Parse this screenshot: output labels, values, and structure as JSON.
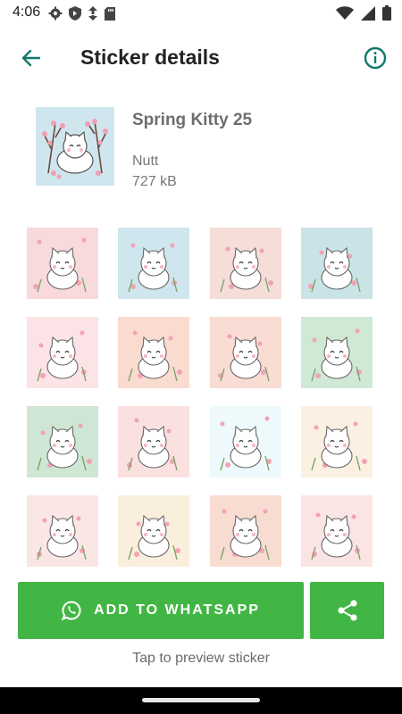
{
  "status_bar": {
    "time": "4:06",
    "left_icons": [
      "gear-icon",
      "shield-icon",
      "data-saver-icon",
      "sd-card-icon"
    ],
    "right_icons": [
      "wifi-icon",
      "signal-icon",
      "battery-icon"
    ]
  },
  "app_bar": {
    "title": "Sticker details",
    "back_icon": "arrow-left-icon",
    "info_icon": "info-icon",
    "accent": "#0f7a6b"
  },
  "pack": {
    "name": "Spring Kitty 25",
    "author": "Nutt",
    "size": "727 kB"
  },
  "stickers": [
    {
      "bg": "#f8d9dc",
      "motif": "winking-kitty"
    },
    {
      "bg": "#cfe6ee",
      "motif": "kitty-cherry-branches"
    },
    {
      "bg": "#f6ddd8",
      "motif": "sleeping-kitty-flowers"
    },
    {
      "bg": "#c9e3e6",
      "motif": "angry-kitty"
    },
    {
      "bg": "#fbe3e6",
      "motif": "kitty-bouquet"
    },
    {
      "bg": "#fadbd0",
      "motif": "three-kitties"
    },
    {
      "bg": "#f9dcd3",
      "motif": "kitty-garden"
    },
    {
      "bg": "#cfe9d5",
      "motif": "kitty-moon"
    },
    {
      "bg": "#cfe6d4",
      "motif": "kitty-branch"
    },
    {
      "bg": "#fbe0e0",
      "motif": "happy-kitty-flower"
    },
    {
      "bg": "#eef9fb",
      "motif": "dancing-kitty"
    },
    {
      "bg": "#fbf0e1",
      "motif": "kitty-pots"
    },
    {
      "bg": "#fbe6e6",
      "motif": "kitty-scarf"
    },
    {
      "bg": "#faeedd",
      "motif": "kitty-blossom-tree"
    },
    {
      "bg": "#f8dcd2",
      "motif": "shy-kitty"
    },
    {
      "bg": "#fbe4e4",
      "motif": "kitty-wreath"
    }
  ],
  "actions": {
    "add_label": "ADD TO WHATSAPP",
    "add_icon": "whatsapp-icon",
    "share_icon": "share-icon",
    "button_color": "#42b644"
  },
  "hint": "Tap to preview sticker"
}
